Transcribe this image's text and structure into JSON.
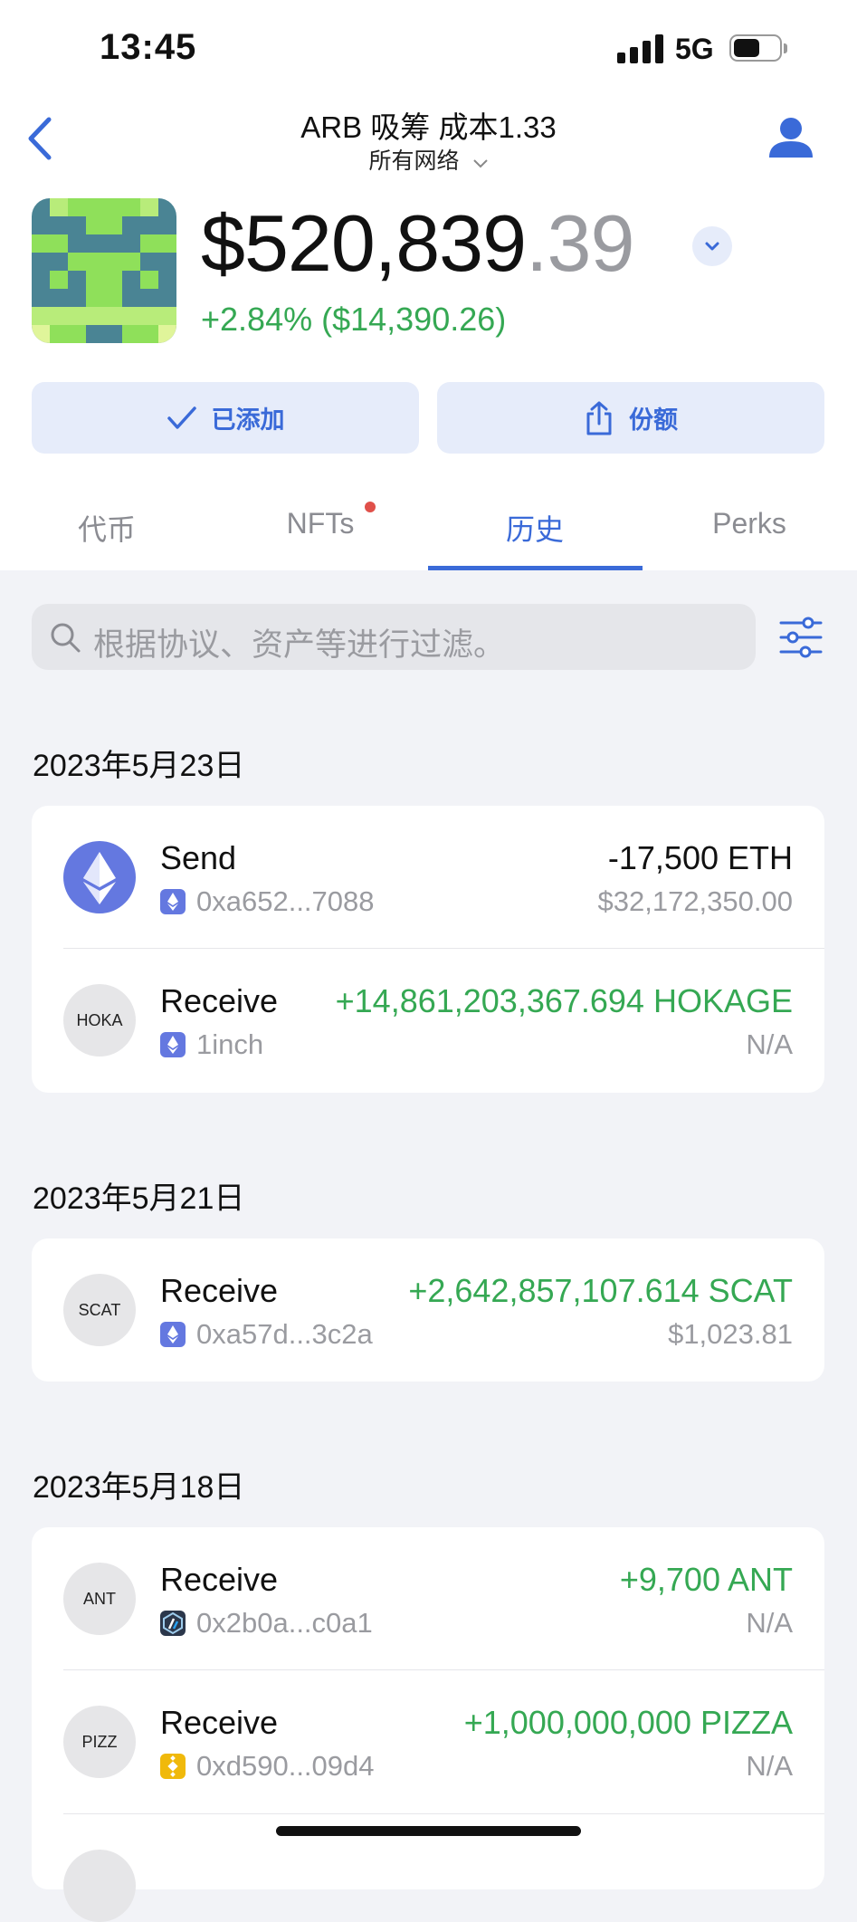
{
  "status_bar": {
    "time": "13:45",
    "network": "5G"
  },
  "header": {
    "title": "ARB 吸筹 成本1.33",
    "subtitle": "所有网络"
  },
  "wallet": {
    "balance_main": "$520,839",
    "balance_cents": ".39",
    "change": "+2.84% ($14,390.26)"
  },
  "actions": {
    "added_label": "已添加",
    "share_label": "份额"
  },
  "tabs": [
    {
      "label": "代币"
    },
    {
      "label": "NFTs"
    },
    {
      "label": "历史"
    },
    {
      "label": "Perks"
    }
  ],
  "active_tab": "历史",
  "search": {
    "placeholder": "根据协议、资产等进行过滤。"
  },
  "history": [
    {
      "date": "2023年5月23日",
      "items": [
        {
          "coin": "ETH",
          "type": "Send",
          "address": "0xa652...7088",
          "amount": "-17,500 ETH",
          "value": "$32,172,350.00",
          "chain": "ethereum"
        },
        {
          "coin": "HOKA",
          "type": "Receive",
          "address": "1inch",
          "amount": "+14,861,203,367.694 HOKAGE",
          "value": "N/A",
          "chain": "ethereum"
        }
      ]
    },
    {
      "date": "2023年5月21日",
      "items": [
        {
          "coin": "SCAT",
          "type": "Receive",
          "address": "0xa57d...3c2a",
          "amount": "+2,642,857,107.614 SCAT",
          "value": "$1,023.81",
          "chain": "ethereum"
        }
      ]
    },
    {
      "date": "2023年5月18日",
      "items": [
        {
          "coin": "ANT",
          "type": "Receive",
          "address": "0x2b0a...c0a1",
          "amount": "+9,700 ANT",
          "value": "N/A",
          "chain": "arbitrum"
        },
        {
          "coin": "PIZZ",
          "type": "Receive",
          "address": "0xd590...09d4",
          "amount": "+1,000,000,000 PIZZA",
          "value": "N/A",
          "chain": "bnb"
        }
      ]
    }
  ],
  "colors": {
    "accent": "#3a6ad8",
    "positive": "#35a853",
    "muted": "#9a9ba0",
    "background": "#f2f3f7"
  }
}
